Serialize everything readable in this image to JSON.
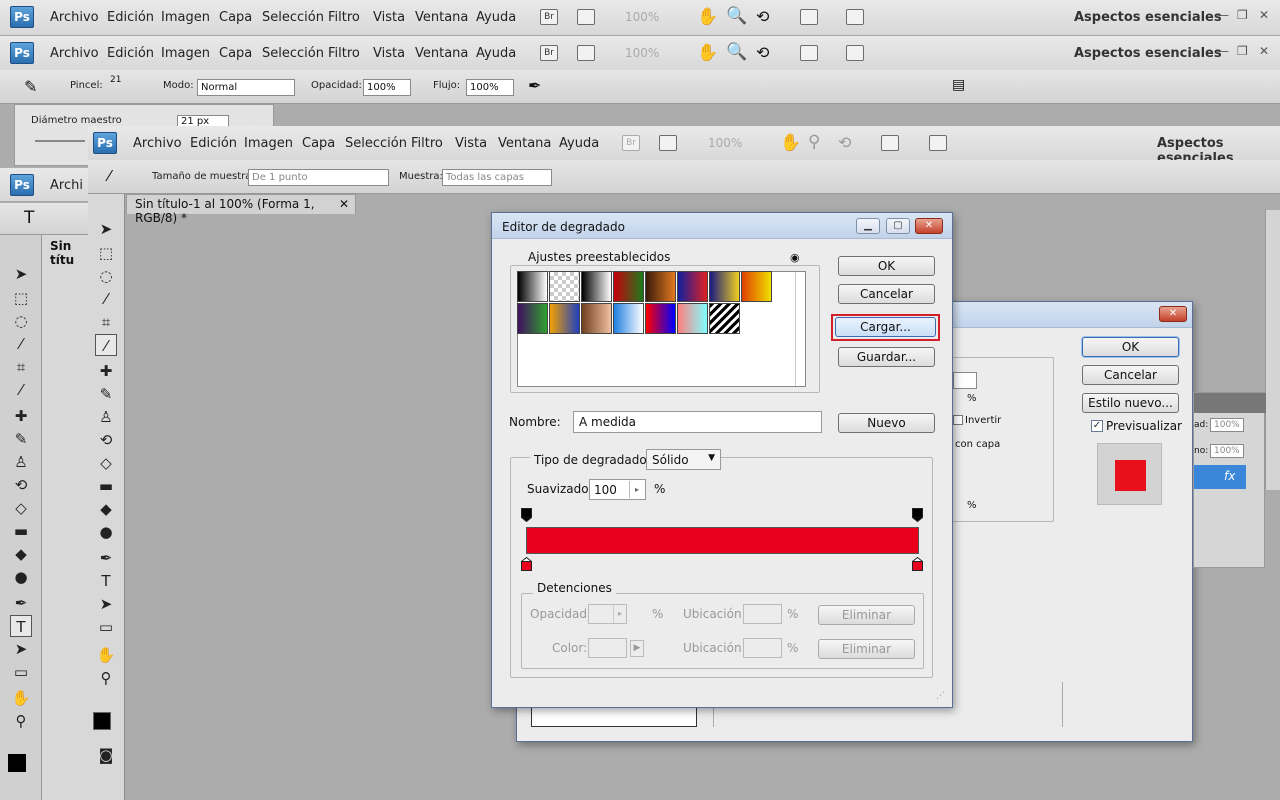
{
  "app_menu": [
    "Archivo",
    "Edición",
    "Imagen",
    "Capa",
    "Selección",
    "Filtro",
    "Vista",
    "Ventana",
    "Ayuda"
  ],
  "ps_logo": "Ps",
  "bridge_label": "Br",
  "zoom_level": "100%",
  "workspace": "Aspectos esenciales",
  "brush_options": {
    "brush_label": "Pincel:",
    "brush_size": "21",
    "mode_label": "Modo:",
    "mode_value": "Normal",
    "opacity_label": "Opacidad:",
    "opacity_value": "100%",
    "flow_label": "Flujo:",
    "flow_value": "100%"
  },
  "brush_popup": {
    "diameter_label": "Diámetro maestro",
    "diameter_value": "21 px"
  },
  "eyedropper_options": {
    "sample_size_label": "Tamaño de muestra:",
    "sample_size_value": "De 1 punto",
    "sample_label": "Muestra:",
    "sample_value": "Todas las capas"
  },
  "back_doc_tab": "Sin títu",
  "back_menu_partial": "Archi",
  "doc_tab": "Sin título-1 al 100% (Forma 1, RGB/8) *",
  "gradient_editor": {
    "title": "Editor de degradado",
    "presets_label": "Ajustes preestablecidos",
    "ok": "OK",
    "cancel": "Cancelar",
    "load": "Cargar...",
    "save": "Guardar...",
    "name_label": "Nombre:",
    "name_value": "A medida",
    "new": "Nuevo",
    "gradient_type_label": "Tipo de degradado:",
    "gradient_type_value": "Sólido",
    "smoothness_label": "Suavizado:",
    "smoothness_value": "100",
    "percent": "%",
    "stops_label": "Detenciones",
    "stops_opacity_label": "Opacidad:",
    "stops_location_label": "Ubicación:",
    "stops_color_label": "Color:",
    "delete": "Eliminar",
    "gradient_color": "#e8001c",
    "presets": [
      [
        "#000",
        "#fff"
      ],
      [
        "#bbb",
        "#eee"
      ],
      [
        "#000",
        "#fff"
      ],
      [
        "#c8000a",
        "#1d7a1d"
      ],
      [
        "#3a1a0a",
        "#e07a20"
      ],
      [
        "#1020a0",
        "#e02020"
      ],
      [
        "#1a1a80",
        "#f0d020"
      ],
      [
        "#e04000",
        "#f0e000"
      ],
      [
        "#401060",
        "#30a030"
      ],
      [
        "#f0a000",
        "#2040c0"
      ],
      [
        "#704020",
        "#f0c0a0"
      ],
      [
        "#2080e0",
        "#ffffff"
      ],
      [
        "#ff0000",
        "#0000ff"
      ],
      [
        "#ff8080",
        "#80ffff"
      ],
      [
        "#ffffff",
        "#000000"
      ]
    ]
  },
  "layer_style": {
    "ok": "OK",
    "cancel": "Cancelar",
    "new_style": "Estilo nuevo...",
    "preview_label": "Previsualizar",
    "invert_label": "Invertir",
    "align_partial": "con capa",
    "percent": "%",
    "preview_color": "#e8101a"
  },
  "layers_panel": {
    "opacity_value": "100%",
    "fill_value": "100%",
    "fill_partial": "no:",
    "opacity_partial": "ad:"
  }
}
